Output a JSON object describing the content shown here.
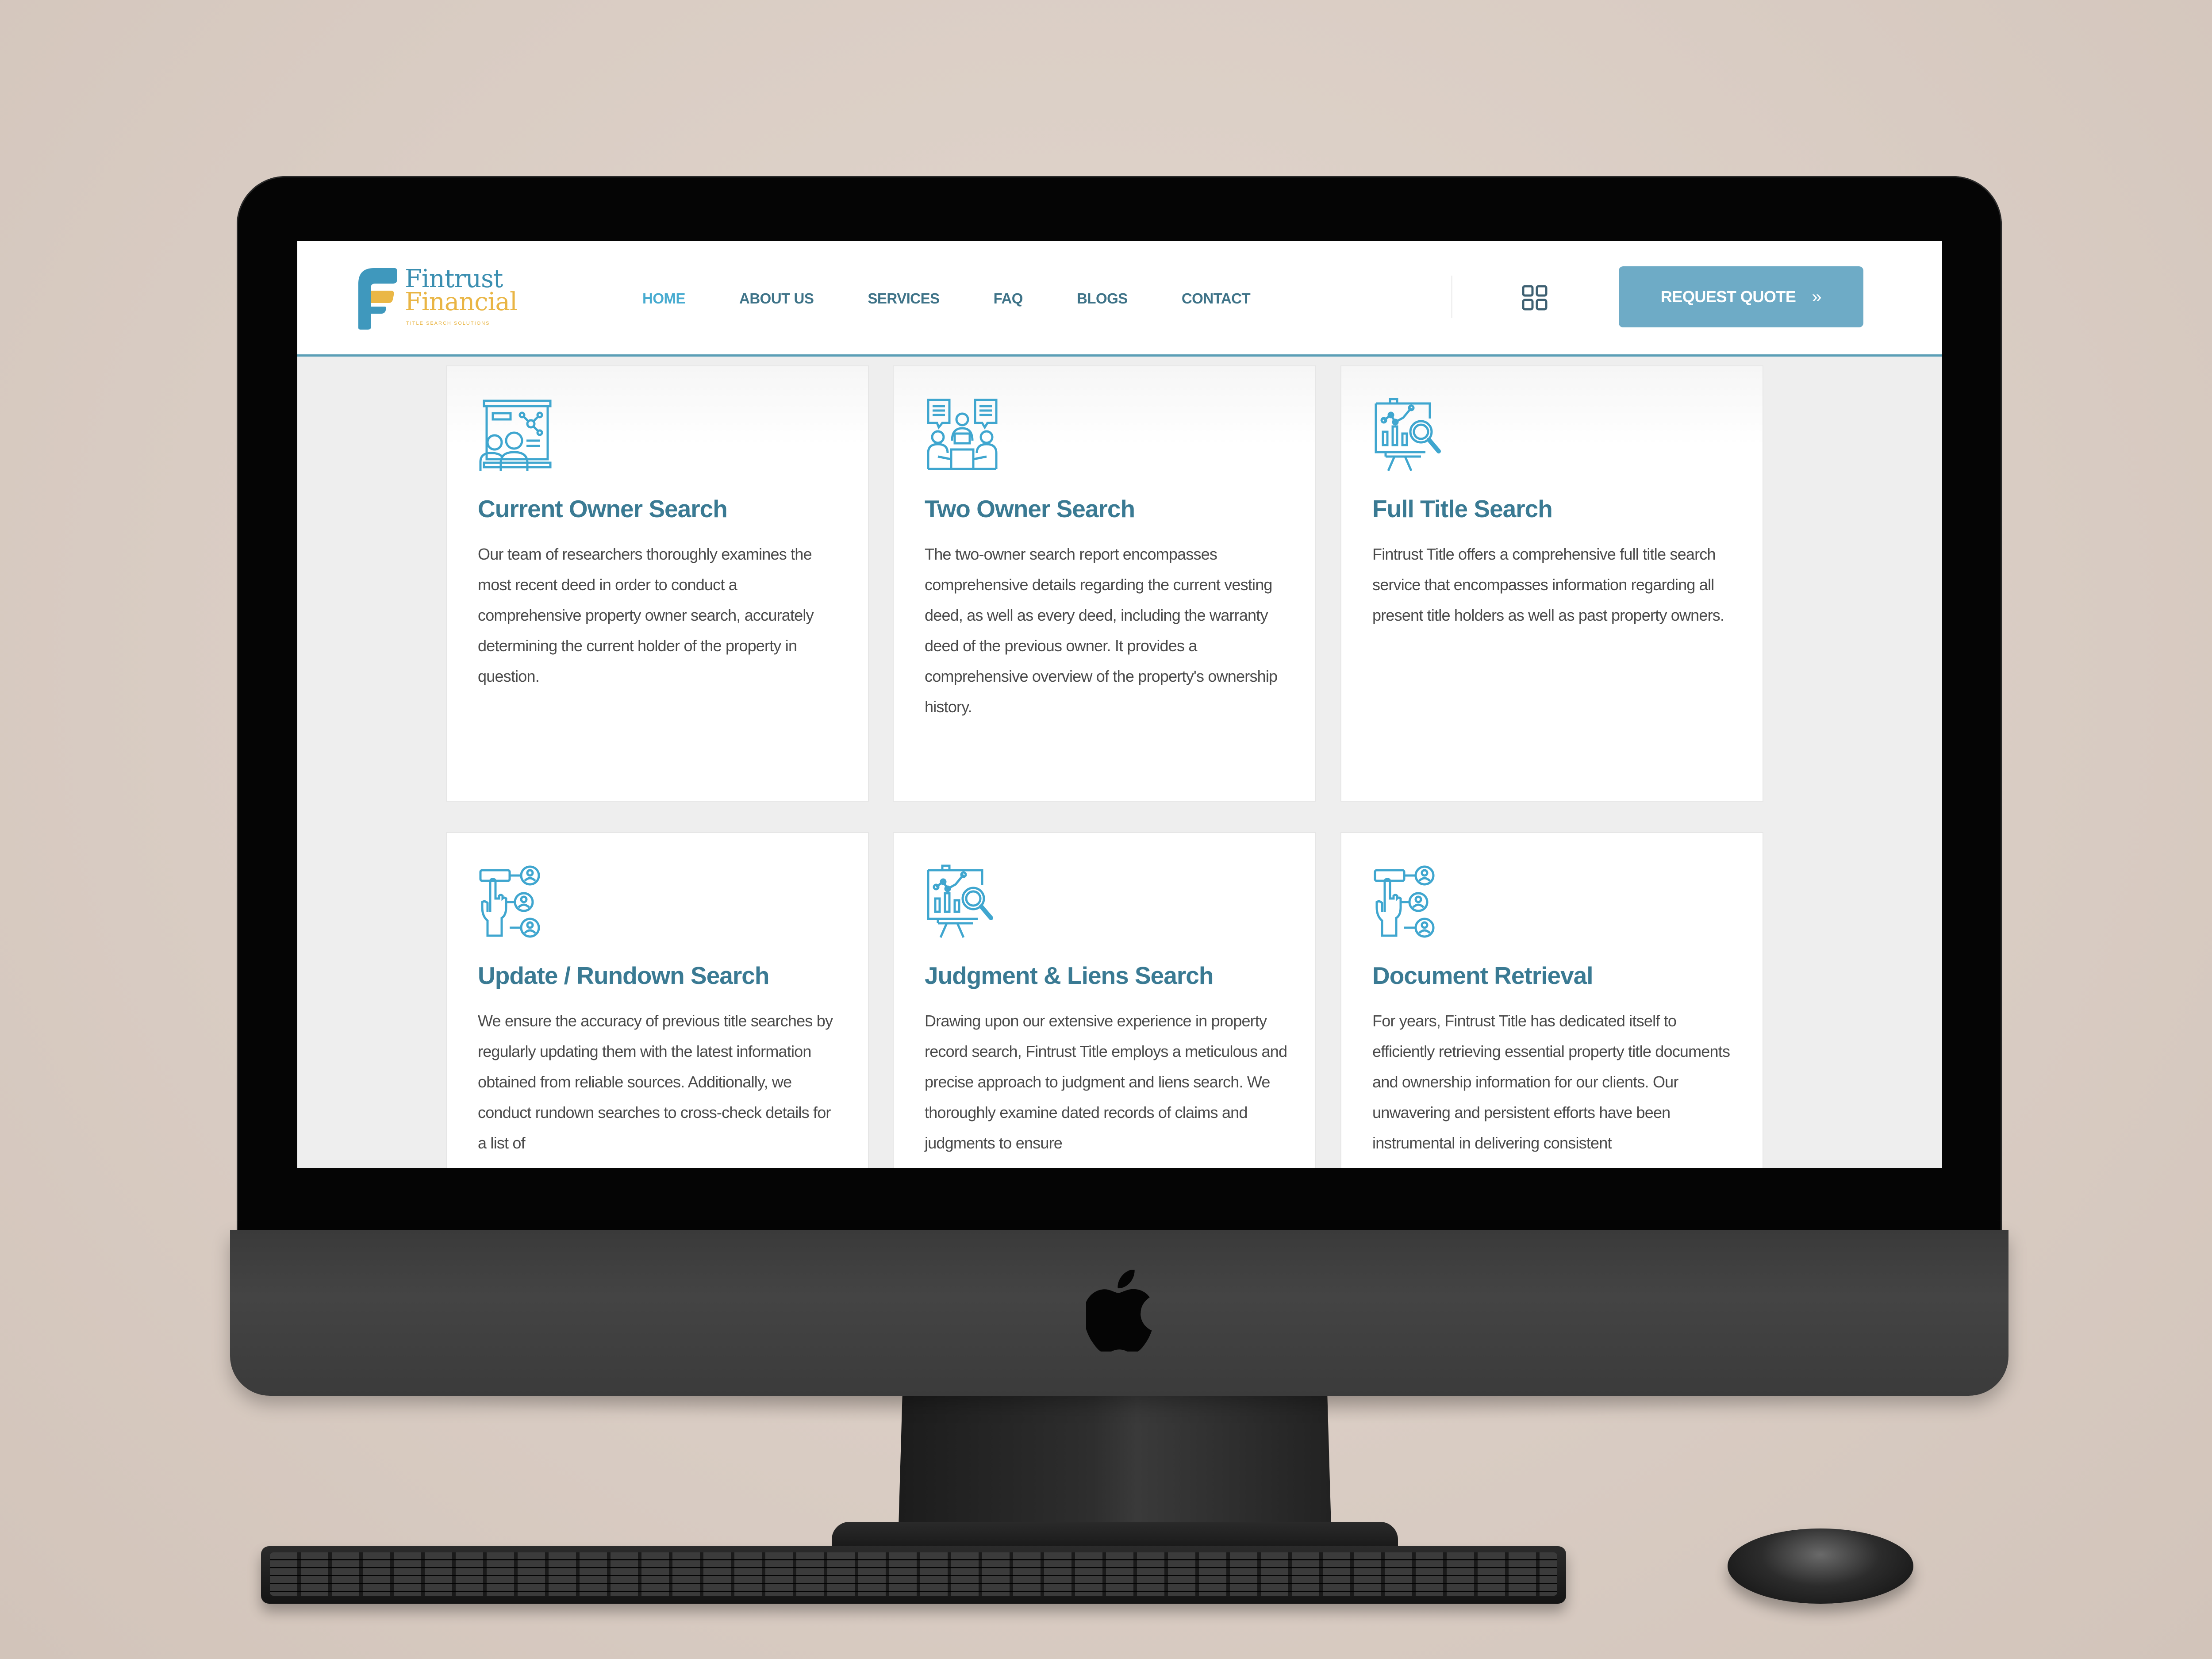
{
  "site": {
    "brand": {
      "word1": "Fintrust",
      "word2": "Financial",
      "tagline": "TITLE SEARCH SOLUTIONS",
      "colors": {
        "primary": "#3a8eb0",
        "accent": "#e9b544"
      }
    },
    "nav": {
      "items": [
        {
          "label": "HOME",
          "active": true
        },
        {
          "label": "ABOUT US",
          "active": false
        },
        {
          "label": "SERVICES",
          "active": false
        },
        {
          "label": "FAQ",
          "active": false
        },
        {
          "label": "BLOGS",
          "active": false
        },
        {
          "label": "CONTACT",
          "active": false
        }
      ]
    },
    "header_actions": {
      "menu_icon": "grid-icon",
      "quote_button": {
        "label": "REQUEST QUOTE",
        "icon": "double-chevron-right-icon"
      }
    },
    "services": [
      {
        "icon": "presentation-team-icon",
        "title": "Current Owner Search",
        "text": "Our team of researchers thoroughly examines the most recent deed in order to conduct a comprehensive property owner search, accurately determining the current holder of the property in question."
      },
      {
        "icon": "meeting-discussion-icon",
        "title": "Two Owner Search",
        "text": "The two-owner search report encompasses comprehensive details regarding the current vesting deed, as well as every deed, including the warranty deed of the previous owner. It provides a comprehensive overview of the property's ownership history."
      },
      {
        "icon": "chart-magnifier-icon",
        "title": "Full Title Search",
        "text": "Fintrust Title offers a comprehensive full title search service that encompasses information regarding all present title holders as well as past property owners."
      },
      {
        "icon": "hand-network-users-icon",
        "title": "Update / Rundown Search",
        "text": "We ensure the accuracy of previous title searches by regularly updating them with the latest information obtained from reliable sources. Additionally, we conduct rundown searches to cross-check details for a list of"
      },
      {
        "icon": "chart-magnifier-icon",
        "title": "Judgment & Liens Search",
        "text": "Drawing upon our extensive experience in property record search, Fintrust Title employs a meticulous and precise approach to judgment and liens search. We thoroughly examine dated records of claims and judgments to ensure"
      },
      {
        "icon": "hand-network-users-icon",
        "title": "Document Retrieval",
        "text": "For years, Fintrust Title has dedicated itself to efficiently retrieving essential property title documents and ownership information for our clients. Our unwavering and persistent efforts have been instrumental in delivering consistent"
      }
    ],
    "colors": {
      "heading": "#3a7a93",
      "icon": "#3fa6cf",
      "button": "#6eabc6",
      "header_rule": "#5b9fb6"
    }
  },
  "device": {
    "type": "desktop-monitor-mockup",
    "logo_icon": "apple-logo-icon"
  }
}
